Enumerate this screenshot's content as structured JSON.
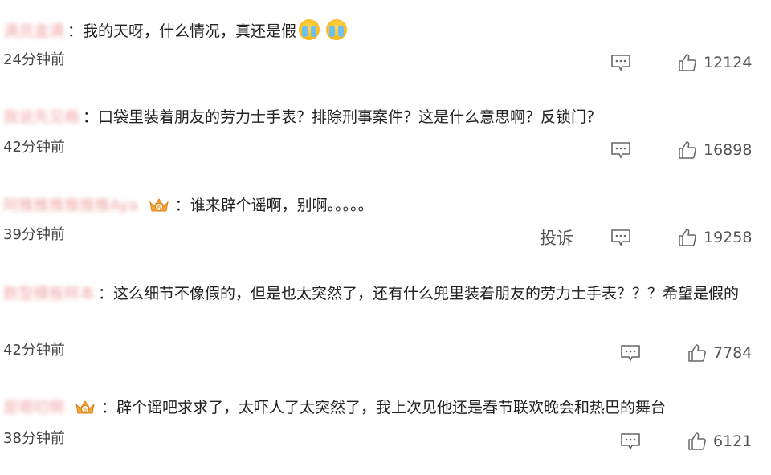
{
  "comments": [
    {
      "username": "满员盒满",
      "text": "：我的天呀，什么情况，真还是假",
      "emojis": [
        "crying-face-emoji",
        "crying-face-emoji"
      ],
      "time": "24分钟前",
      "likes": "12124"
    },
    {
      "username": "我说先见格",
      "text": "：口袋里装着朋友的劳力士手表？排除刑事案件？这是什么意思啊？反锁门？",
      "time": "42分钟前",
      "likes": "16898"
    },
    {
      "username": "阿推推推推推推Aya",
      "text": "：谁来辟个谣啊，别啊。。。。。",
      "badge": "vip-crown-badge",
      "time": "39分钟前",
      "report_label": "投诉",
      "likes": "19258"
    },
    {
      "username": "数型模板样本",
      "text": "：这么细节不像假的，但是也太突然了，还有什么兜里装着朋友的劳力士手表？？？希望是假的",
      "time": "42分钟前",
      "likes": "7784"
    },
    {
      "username": "是嗯叨啊",
      "text": "：辟个谣吧求求了，太吓人了太突然了，我上次见他还是春节联欢晚会和热巴的舞台",
      "badge": "vip-crown-badge",
      "time": "38分钟前",
      "likes": "6121"
    }
  ],
  "colors": {
    "text": "#222222",
    "meta": "#555555",
    "username_blur": "#f0a6a6",
    "crown": "#f2a33a"
  },
  "icons": {
    "reply": "comment-icon",
    "like": "thumbs-up-icon"
  }
}
